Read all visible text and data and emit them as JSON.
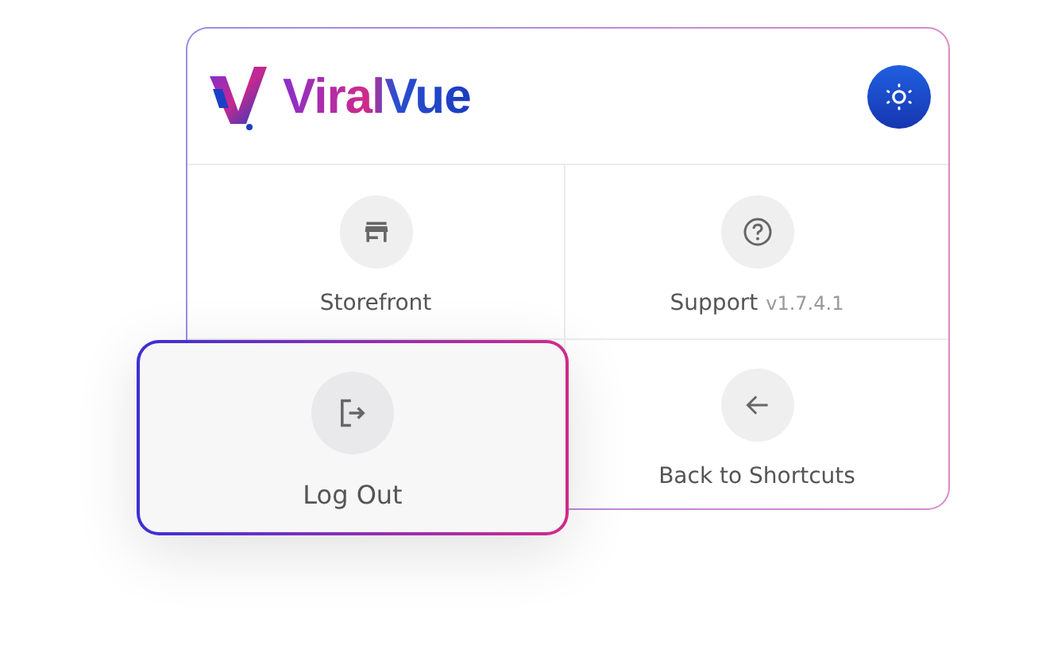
{
  "brand": {
    "name": "ViralVue"
  },
  "shortcuts": [
    {
      "label": "Storefront",
      "kind": "store",
      "raised": false
    },
    {
      "label": "Support",
      "version": "v1.7.4.1",
      "kind": "help",
      "raised": false
    },
    {
      "label": "Log Out",
      "kind": "logout",
      "raised": true
    },
    {
      "label": "Back to Shortcuts",
      "kind": "back",
      "raised": false
    }
  ]
}
